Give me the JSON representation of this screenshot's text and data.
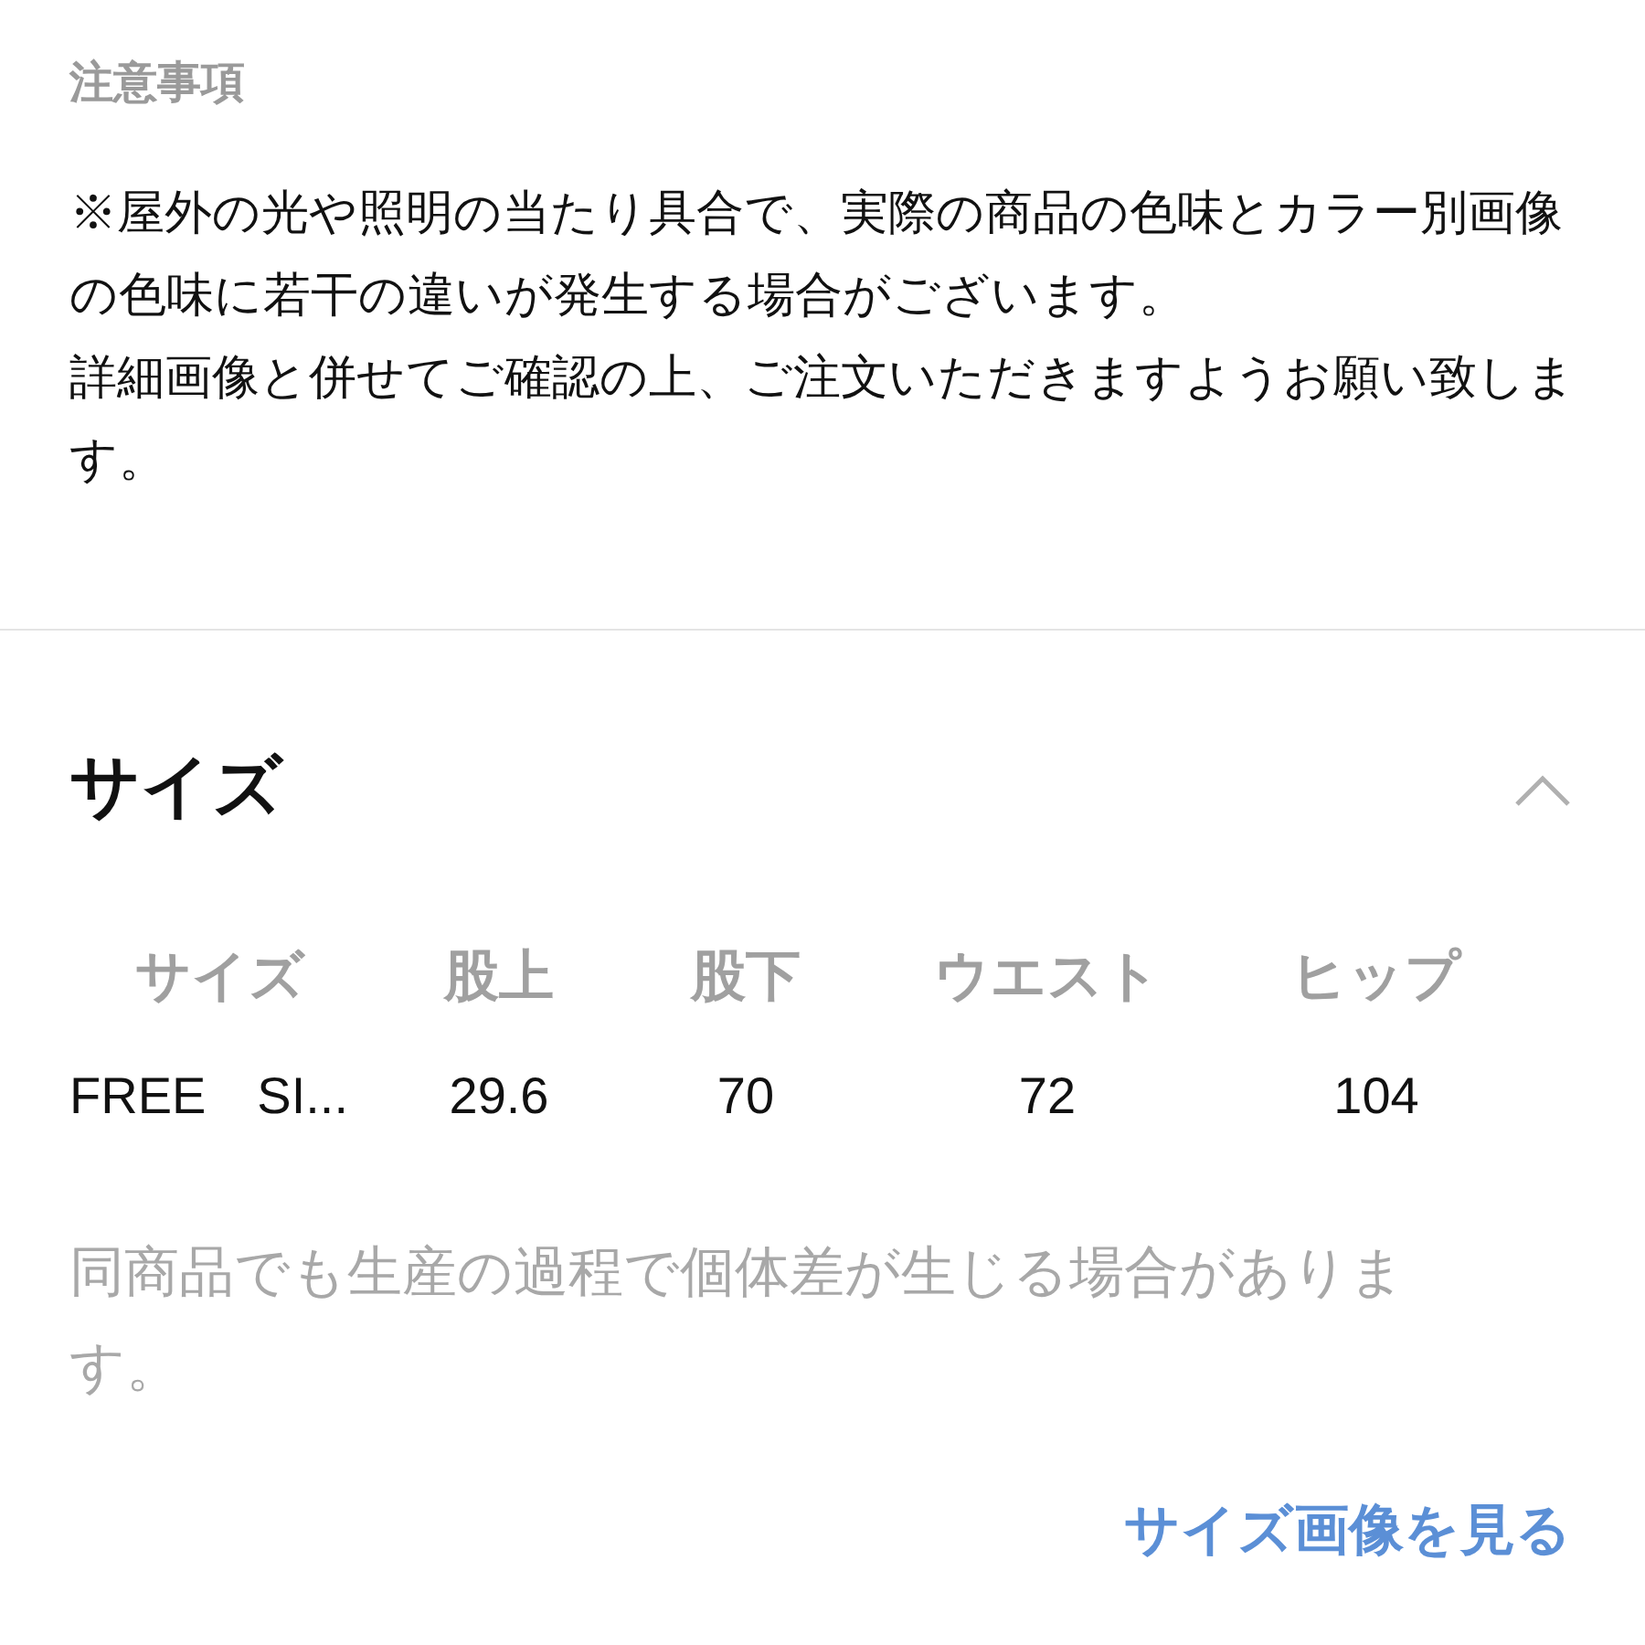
{
  "notice": {
    "title": "注意事項",
    "paragraphs": [
      "※屋外の光や照明の当たり具合で、実際の商品の色味とカラー別画像の色味に若干の違いが発生する場合がございます。",
      "詳細画像と併せてご確認の上、ご注文いただきますようお願い致します。"
    ]
  },
  "size_section": {
    "title": "サイズ",
    "expanded": true,
    "table": {
      "columns": [
        "サイズ",
        "股上",
        "股下",
        "ウエスト",
        "ヒップ"
      ],
      "rows": [
        [
          "FREE　SI...",
          "29.6",
          "70",
          "72",
          "104"
        ]
      ]
    },
    "note": "同商品でも生産の過程で個体差が生じる場合があります。",
    "link": "サイズ画像を見る"
  }
}
